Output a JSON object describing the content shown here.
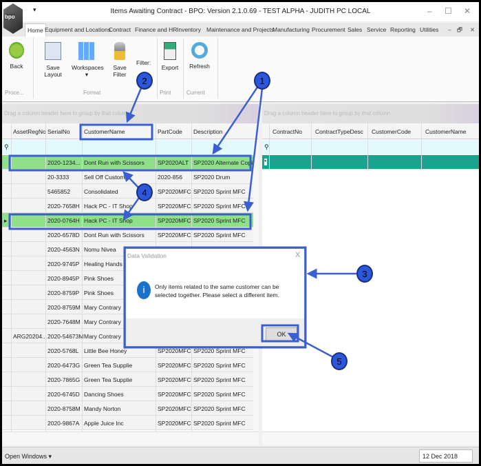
{
  "window": {
    "title": "Items Awaiting Contract - BPO: Version 2.1.0.69 - TEST ALPHA - JUDITH PC LOCAL",
    "logo": "bpo"
  },
  "tabs": [
    "Home",
    "Equipment and Locations",
    "Contract",
    "Finance and HR",
    "Inventory",
    "Maintenance and Projects",
    "Manufacturing",
    "Procurement",
    "Sales",
    "Service",
    "Reporting",
    "Utilities"
  ],
  "ribbon": {
    "back": "Back",
    "save_layout": "Save Layout",
    "workspaces": "Workspaces",
    "save_filter": "Save Filter",
    "filter": "Filter:",
    "export": "Export",
    "refresh": "Refresh",
    "groups": {
      "process": "Proce...",
      "format": "Format",
      "print": "Print",
      "current": "Current"
    }
  },
  "group_hint": "Drag a column header here to group by that column",
  "left_grid": {
    "columns": [
      "AssetRegNo",
      "SerialNo",
      "CustomerName",
      "PartCode",
      "Description"
    ],
    "rows": [
      [
        "",
        "2020-1234...",
        "Dont Run with Scissors",
        "SP2020ALT",
        "SP2020 Alternate Copier"
      ],
      [
        "",
        "20-3333",
        "Sell Off Customer",
        "2020-856",
        "SP2020 Drum"
      ],
      [
        "",
        "5465852",
        "Consolidated",
        "SP2020MFC",
        "SP2020 Sprint MFC"
      ],
      [
        "",
        "2020-7658H",
        "Hack PC - IT Shop",
        "SP2020MFC",
        "SP2020 Sprint MFC"
      ],
      [
        "",
        "2020-0764H",
        "Hack PC - IT Shop",
        "SP2020MFC",
        "SP2020 Sprint MFC"
      ],
      [
        "",
        "2020-6578D",
        "Dont Run with Scissors",
        "SP2020MFC",
        "SP2020 Sprint MFC"
      ],
      [
        "",
        "2020-4563N",
        "Nomu Nivea",
        "",
        ""
      ],
      [
        "",
        "2020-9745P",
        "Healing Hands",
        "",
        ""
      ],
      [
        "",
        "2020-8945P",
        "Pink Shoes",
        "",
        ""
      ],
      [
        "",
        "2020-8759P",
        "Pink Shoes",
        "",
        ""
      ],
      [
        "",
        "2020-8759M",
        "Mary Contrary",
        "",
        ""
      ],
      [
        "",
        "2020-7648M",
        "Mary Contrary",
        "",
        ""
      ],
      [
        "ARG20204...",
        "2020-54673M",
        "Mary Contrary",
        "",
        ""
      ],
      [
        "",
        "2020-5768L",
        "Little Bee Honey",
        "SP2020MFC",
        "SP2020 Sprint MFC"
      ],
      [
        "",
        "2020-6473G",
        "Green Tea Supplie",
        "SP2020MFC",
        "SP2020 Sprint MFC"
      ],
      [
        "",
        "2020-7865G",
        "Green Tea Supplie",
        "SP2020MFC",
        "SP2020 Sprint MFC"
      ],
      [
        "",
        "2020-6745D",
        "Dancing Shoes",
        "SP2020MFC",
        "SP2020 Sprint MFC"
      ],
      [
        "",
        "2020-8758M",
        "Mandy Norton",
        "SP2020MFC",
        "SP2020 Sprint MFC"
      ],
      [
        "",
        "2020-9867A",
        "Apple Juice Inc",
        "SP2020MFC",
        "SP2020 Sprint MFC"
      ]
    ],
    "selected_rows": [
      0,
      4
    ]
  },
  "right_grid": {
    "columns": [
      "ContractNo",
      "ContractTypeDesc",
      "CustomerCode",
      "CustomerName"
    ],
    "new_row_color": "#1aa38f"
  },
  "dialog": {
    "title": "Data Validation",
    "message": "Only items related to the same customer can be selected together. Please select a different item.",
    "ok": "OK",
    "close": "X"
  },
  "status": {
    "open_windows": "Open Windows ▾",
    "date": "12 Dec 2018"
  },
  "annotations": [
    "1",
    "2",
    "3",
    "4",
    "5"
  ],
  "colors": {
    "annotation": "#3a5fd0",
    "selected_row": "#8ee08a"
  }
}
